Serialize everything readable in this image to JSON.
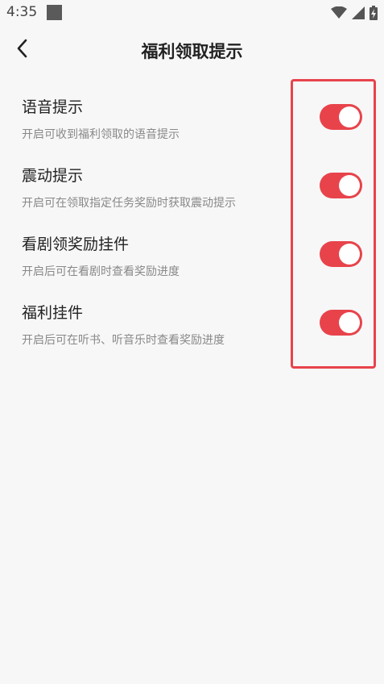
{
  "status_bar": {
    "time": "4:35",
    "icons": [
      "notification-square-icon",
      "wifi-icon",
      "signal-icon",
      "battery-charging-icon"
    ]
  },
  "header": {
    "back_icon": "chevron-left-icon",
    "title": "福利领取提示"
  },
  "settings": [
    {
      "title": "语音提示",
      "description": "开启可收到福利领取的语音提示",
      "enabled": true
    },
    {
      "title": "震动提示",
      "description": "开启可在领取指定任务奖励时获取震动提示",
      "enabled": true
    },
    {
      "title": "看剧领奖励挂件",
      "description": "开启后可在看剧时查看奖励进度",
      "enabled": true
    },
    {
      "title": "福利挂件",
      "description": "开启后可在听书、听音乐时查看奖励进度",
      "enabled": true
    }
  ],
  "colors": {
    "accent": "#e8434b",
    "background": "#f7f7f7",
    "title_text": "#222222",
    "description_text": "#888888"
  }
}
